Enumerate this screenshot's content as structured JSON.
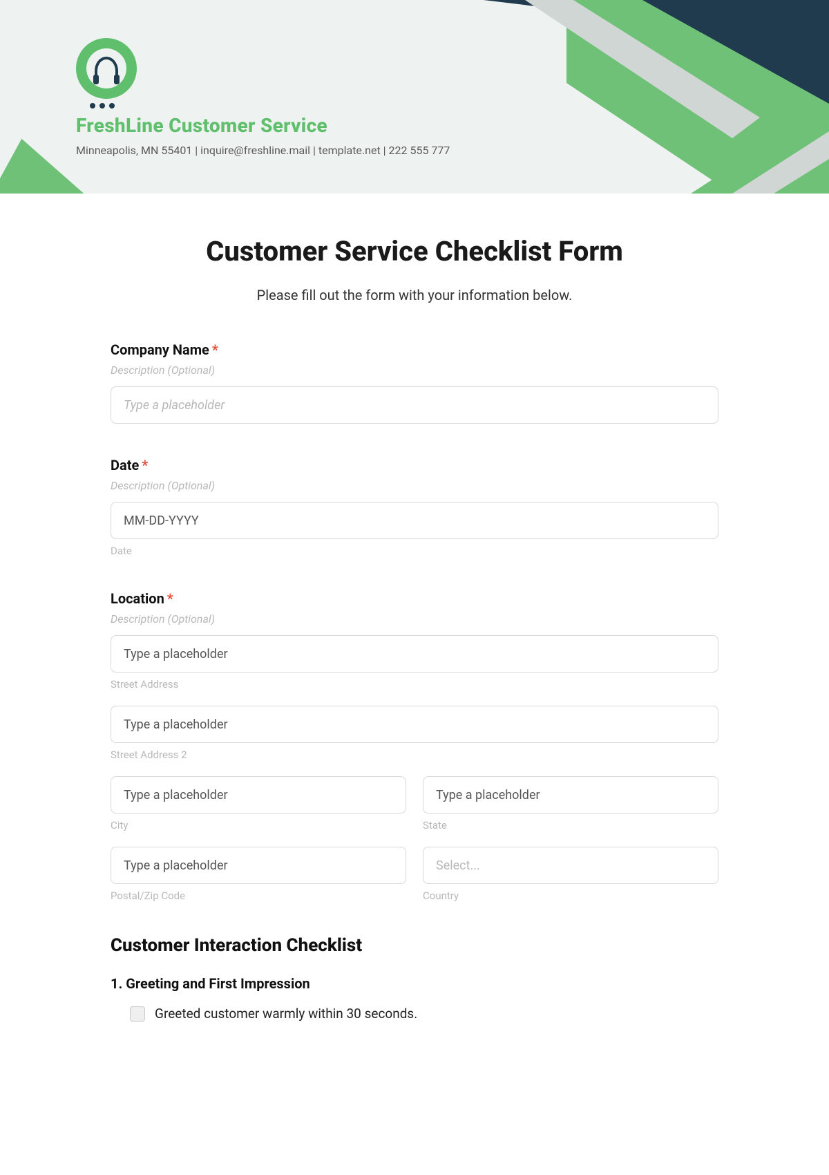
{
  "header": {
    "brand_title": "FreshLine Customer Service",
    "brand_sub": "Minneapolis, MN 55401 | inquire@freshline.mail | template.net | 222 555 777"
  },
  "form": {
    "title": "Customer Service Checklist Form",
    "subtitle": "Please fill out the form with your information below.",
    "required_mark": "*",
    "desc_placeholder": "Description (Optional)",
    "fields": {
      "company_name": {
        "label": "Company Name",
        "placeholder": "Type a placeholder"
      },
      "date": {
        "label": "Date",
        "placeholder": "MM-DD-YYYY",
        "sublabel": "Date"
      },
      "location": {
        "label": "Location",
        "street1": {
          "placeholder": "Type a placeholder",
          "sublabel": "Street Address"
        },
        "street2": {
          "placeholder": "Type a placeholder",
          "sublabel": "Street Address 2"
        },
        "city": {
          "placeholder": "Type a placeholder",
          "sublabel": "City"
        },
        "state": {
          "placeholder": "Type a placeholder",
          "sublabel": "State"
        },
        "postal": {
          "placeholder": "Type a placeholder",
          "sublabel": "Postal/Zip Code"
        },
        "country": {
          "placeholder": "Select...",
          "sublabel": "Country"
        }
      }
    },
    "checklist": {
      "section_title": "Customer Interaction Checklist",
      "sub1_title": "1. Greeting and First Impression",
      "item1": "Greeted customer warmly within 30 seconds."
    }
  }
}
